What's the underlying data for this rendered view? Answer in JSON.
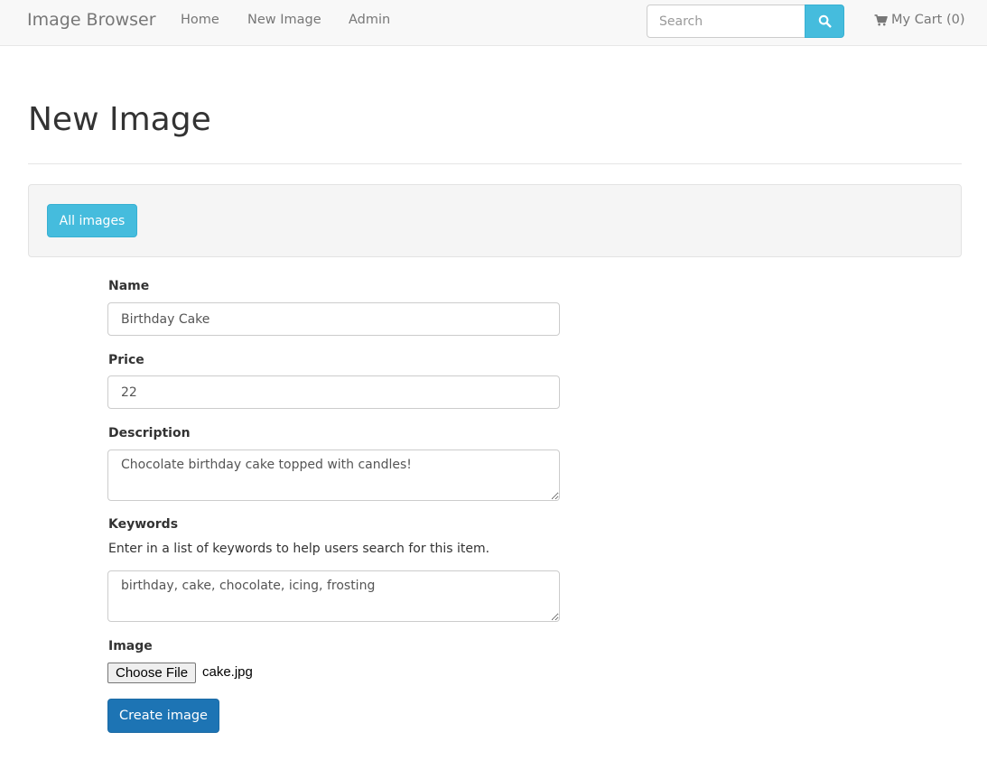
{
  "navbar": {
    "brand": "Image Browser",
    "links": [
      "Home",
      "New Image",
      "Admin"
    ],
    "search_placeholder": "Search",
    "search_icon": "search-icon",
    "cart_icon": "shopping-cart-icon",
    "cart_label": "My Cart (0)"
  },
  "page": {
    "title": "New Image",
    "all_images_button": "All images"
  },
  "form": {
    "name_label": "Name",
    "name_value": "Birthday Cake",
    "price_label": "Price",
    "price_value": "22",
    "description_label": "Description",
    "description_value": "Chocolate birthday cake topped with candles!",
    "keywords_label": "Keywords",
    "keywords_help": "Enter in a list of keywords to help users search for this item.",
    "keywords_value": "birthday, cake, chocolate, icing, frosting",
    "image_label": "Image",
    "file_button": "Choose File",
    "file_name": "cake.jpg",
    "submit_label": "Create image"
  },
  "colors": {
    "info_button": "#45bcdd",
    "primary_button": "#1d74b4",
    "navbar_bg": "#f8f8f8"
  }
}
